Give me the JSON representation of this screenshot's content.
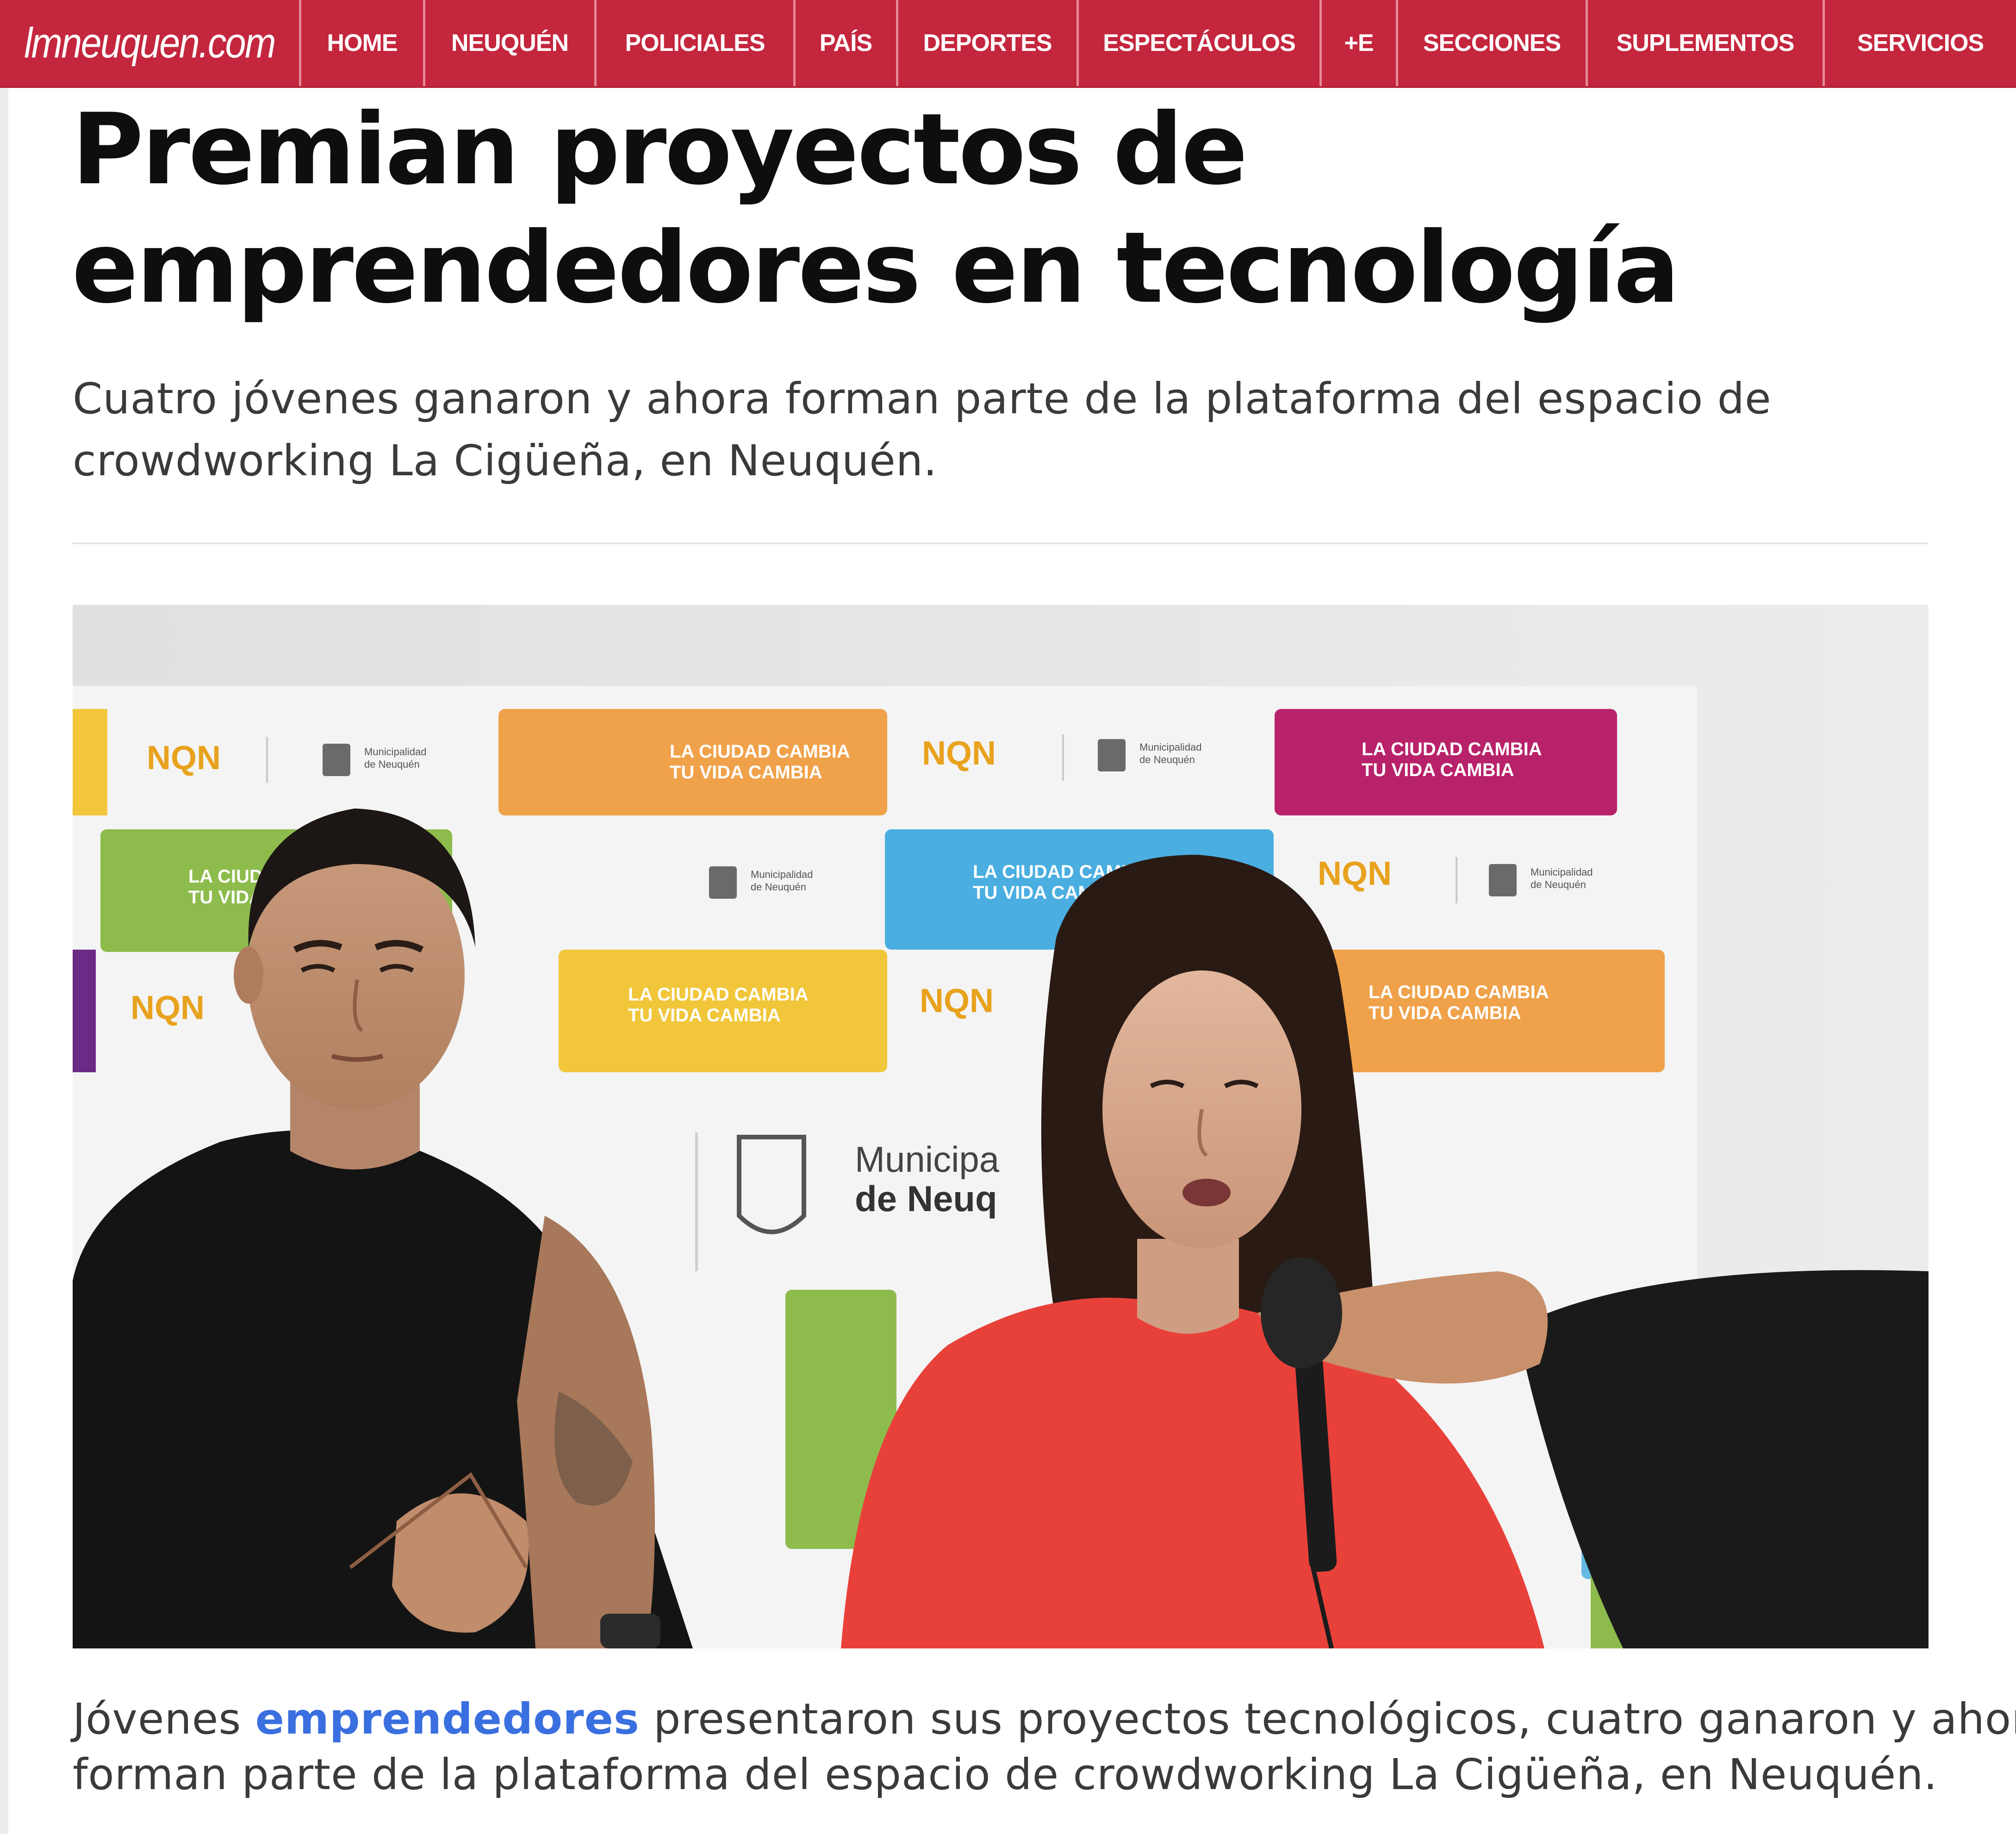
{
  "nav": {
    "brand": "lmneuquen.com",
    "items": [
      {
        "label": "HOME"
      },
      {
        "label": "NEUQUÉN"
      },
      {
        "label": "POLICIALES"
      },
      {
        "label": "PAÍS"
      },
      {
        "label": "DEPORTES"
      },
      {
        "label": "ESPECTÁCULOS"
      },
      {
        "label": "+E"
      },
      {
        "label": "SECCIONES"
      },
      {
        "label": "SUPLEMENTOS"
      },
      {
        "label": "SERVICIOS"
      }
    ]
  },
  "article": {
    "headline_line1": "Premian proyectos de",
    "headline_line2": "emprendedores en tecnología",
    "lead_line1": "Cuatro jóvenes ganaron y ahora forman parte de la plataforma del espacio de",
    "lead_line2": "crowdworking La Cigüeña, en Neuquén.",
    "caption_prefix": "Jóvenes ",
    "caption_link": "emprendedores",
    "caption_rest_line1": " presentaron sus proyectos tecnológicos, cuatro ganaron y ahora",
    "caption_line2": "forman parte de la plataforma del espacio de crowdworking La Cigüeña, en Neuquén."
  },
  "photo": {
    "backdrop_tile_text_1": "LA CIUDAD CAMBIA",
    "backdrop_tile_text_2": "TU VIDA CAMBIA",
    "backdrop_logo": "NQN",
    "backdrop_muni_small_1": "Municipalidad",
    "backdrop_muni_small_2": "de Neuquén",
    "backdrop_muni_large_1": "Municipa",
    "backdrop_muni_large_2": "de Neuq",
    "colors": {
      "orange": "#f0a24a",
      "magenta": "#b8226a",
      "green": "#8dbc4d",
      "blue": "#4aaee0",
      "yellow": "#f1c63b",
      "logo_yellow": "#e8a21e",
      "shirt_red": "#e8413a"
    }
  }
}
